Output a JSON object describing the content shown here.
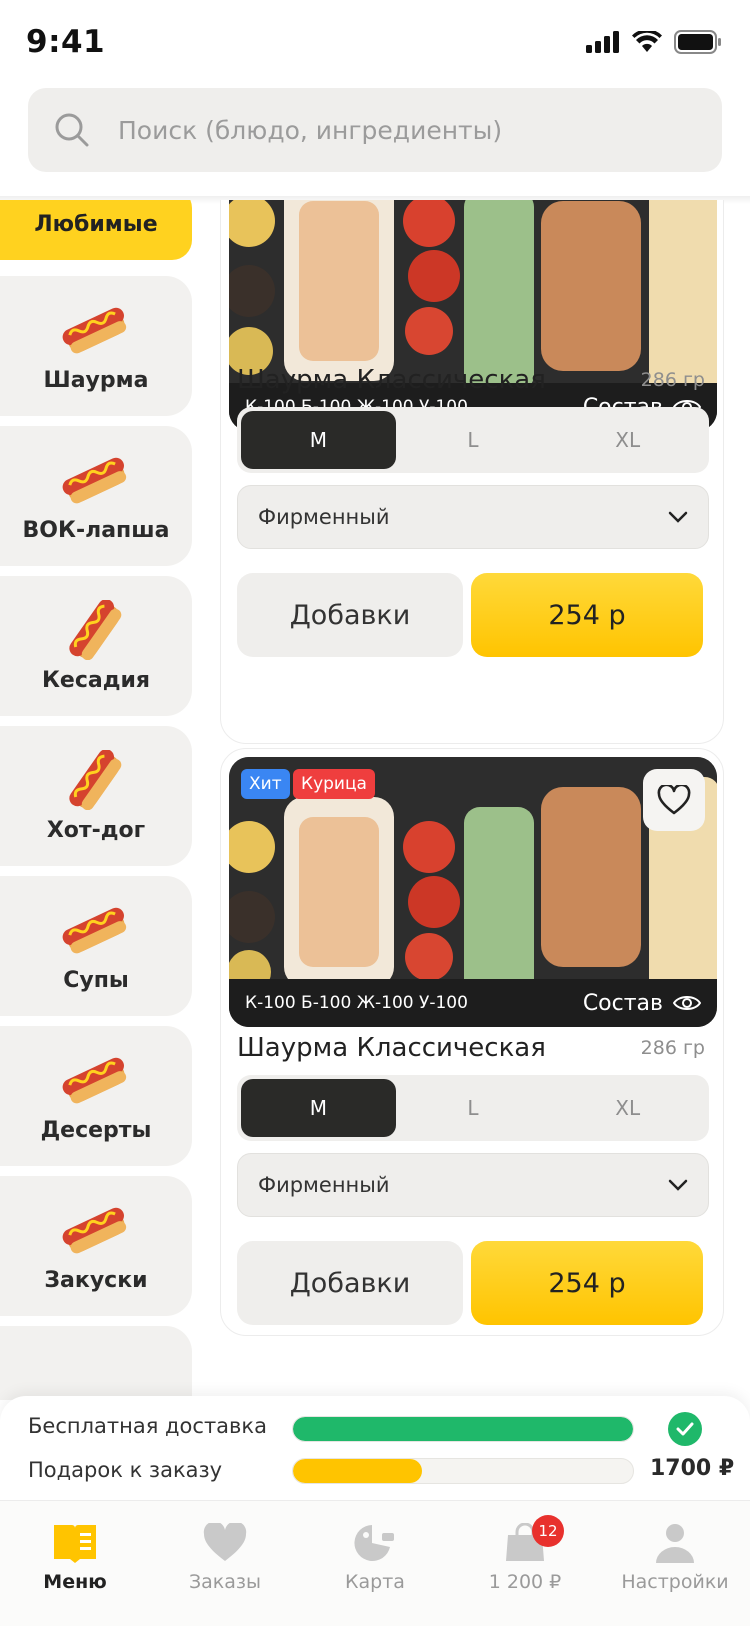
{
  "status": {
    "time": "9:41"
  },
  "search": {
    "placeholder": "Поиск (блюдо, ингредиенты)"
  },
  "categories": [
    {
      "label": "Любимые",
      "icon": "heart-category",
      "active": true
    },
    {
      "label": "Шаурма",
      "icon": "hotdog-icon"
    },
    {
      "label": "ВОК-лапша",
      "icon": "hotdog-icon"
    },
    {
      "label": "Кесадия",
      "icon": "hotdog-icon"
    },
    {
      "label": "Хот-дог",
      "icon": "hotdog-icon"
    },
    {
      "label": "Супы",
      "icon": "hotdog-icon"
    },
    {
      "label": "Десерты",
      "icon": "hotdog-icon"
    },
    {
      "label": "Закуски",
      "icon": "hotdog-icon"
    }
  ],
  "products": [
    {
      "macros": "К-100 Б-100 Ж-100 У-100",
      "recipe_label": "Состав",
      "title": "Шаурма Классическая",
      "weight": "286 гр",
      "sizes": [
        "M",
        "L",
        "XL"
      ],
      "selected_size": "M",
      "sauce": "Фирменный",
      "extras_label": "Добавки",
      "price": "254 р"
    },
    {
      "badges": [
        {
          "text": "Хит",
          "color": "#3a86f3"
        },
        {
          "text": "Курица",
          "color": "#ef3e3e"
        }
      ],
      "macros": "К-100 Б-100 Ж-100 У-100",
      "recipe_label": "Состав",
      "title": "Шаурма Классическая",
      "weight": "286 гр",
      "sizes": [
        "M",
        "L",
        "XL"
      ],
      "selected_size": "M",
      "sauce": "Фирменный",
      "extras_label": "Добавки",
      "price": "254 р"
    }
  ],
  "progress": {
    "delivery": {
      "label": "Бесплатная доставка",
      "fraction": 1.0,
      "color": "#1fb86a"
    },
    "gift": {
      "label": "Подарок к заказу",
      "fraction": 0.38,
      "color": "#ffc400",
      "amount": "1700 ₽"
    }
  },
  "tabs": [
    {
      "label": "Меню",
      "icon": "menu-book-icon",
      "active": true
    },
    {
      "label": "Заказы",
      "icon": "heart-icon"
    },
    {
      "label": "Карта",
      "icon": "map-icon"
    },
    {
      "label": "1 200 ₽",
      "icon": "cart-icon",
      "badge": "12"
    },
    {
      "label": "Настройки",
      "icon": "profile-icon"
    }
  ],
  "colors": {
    "accent": "#ffc400",
    "dark": "#2a2a28",
    "green": "#1fb86a",
    "badge_red": "#e8312d"
  }
}
